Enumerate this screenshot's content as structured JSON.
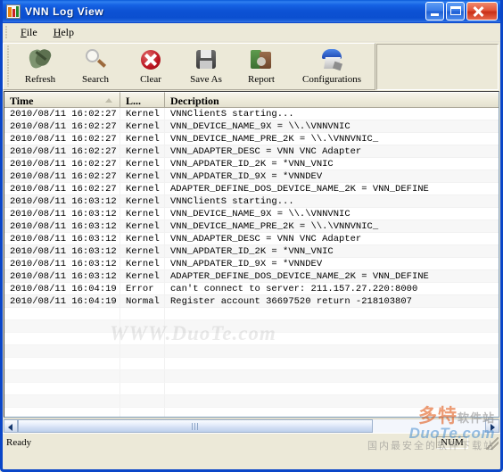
{
  "window": {
    "title": "VNN Log View",
    "icon": "app-icon",
    "controls": {
      "minimize": "Minimize",
      "maximize": "Maximize",
      "close": "Close"
    }
  },
  "menubar": {
    "items": [
      {
        "label": "File",
        "accel": "F"
      },
      {
        "label": "Help",
        "accel": "H"
      }
    ]
  },
  "toolbar": {
    "buttons": [
      {
        "label": "Refresh",
        "icon": "refresh-icon"
      },
      {
        "label": "Search",
        "icon": "search-icon"
      },
      {
        "label": "Clear",
        "icon": "clear-icon"
      },
      {
        "label": "Save As",
        "icon": "save-as-icon"
      },
      {
        "label": "Report",
        "icon": "report-icon"
      },
      {
        "label": "Configurations",
        "icon": "configurations-icon"
      }
    ]
  },
  "log": {
    "columns": [
      {
        "key": "time",
        "label": "Time",
        "sorted": "ascending"
      },
      {
        "key": "level",
        "label": "L..."
      },
      {
        "key": "desc",
        "label": "Decription"
      }
    ],
    "rows": [
      {
        "time": "2010/08/11 16:02:27",
        "level": "Kernel",
        "desc": "VNNClientS starting..."
      },
      {
        "time": "2010/08/11 16:02:27",
        "level": "Kernel",
        "desc": "VNN_DEVICE_NAME_9X = \\\\.\\VNNVNIC"
      },
      {
        "time": "2010/08/11 16:02:27",
        "level": "Kernel",
        "desc": "VNN_DEVICE_NAME_PRE_2K = \\\\.\\VNNVNIC_"
      },
      {
        "time": "2010/08/11 16:02:27",
        "level": "Kernel",
        "desc": "VNN_ADAPTER_DESC = VNN VNC Adapter"
      },
      {
        "time": "2010/08/11 16:02:27",
        "level": "Kernel",
        "desc": "VNN_APDATER_ID_2K = *VNN_VNIC"
      },
      {
        "time": "2010/08/11 16:02:27",
        "level": "Kernel",
        "desc": "VNN_APDATER_ID_9X = *VNNDEV"
      },
      {
        "time": "2010/08/11 16:02:27",
        "level": "Kernel",
        "desc": "ADAPTER_DEFINE_DOS_DEVICE_NAME_2K = VNN_DEFINE"
      },
      {
        "time": "2010/08/11 16:03:12",
        "level": "Kernel",
        "desc": "VNNClientS starting..."
      },
      {
        "time": "2010/08/11 16:03:12",
        "level": "Kernel",
        "desc": "VNN_DEVICE_NAME_9X = \\\\.\\VNNVNIC"
      },
      {
        "time": "2010/08/11 16:03:12",
        "level": "Kernel",
        "desc": "VNN_DEVICE_NAME_PRE_2K = \\\\.\\VNNVNIC_"
      },
      {
        "time": "2010/08/11 16:03:12",
        "level": "Kernel",
        "desc": "VNN_ADAPTER_DESC = VNN VNC Adapter"
      },
      {
        "time": "2010/08/11 16:03:12",
        "level": "Kernel",
        "desc": "VNN_APDATER_ID_2K = *VNN_VNIC"
      },
      {
        "time": "2010/08/11 16:03:12",
        "level": "Kernel",
        "desc": "VNN_APDATER_ID_9X = *VNNDEV"
      },
      {
        "time": "2010/08/11 16:03:12",
        "level": "Kernel",
        "desc": "ADAPTER_DEFINE_DOS_DEVICE_NAME_2K = VNN_DEFINE"
      },
      {
        "time": "2010/08/11 16:04:19",
        "level": "Error",
        "desc": "can't connect to server: 211.157.27.220:8000"
      },
      {
        "time": "2010/08/11 16:04:19",
        "level": "Normal",
        "desc": "Register account 36697520 return -218103807"
      }
    ],
    "empty_row_count": 9
  },
  "scrollbar": {
    "left_arrow": "scroll-left",
    "right_arrow": "scroll-right",
    "thumb": "horizontal-scroll-thumb"
  },
  "statusbar": {
    "message": "Ready",
    "num_indicator": "NUM"
  },
  "watermark": {
    "center": "WWW.DuoTe.com",
    "brand_cn": "多特",
    "brand_cn_suffix": "软件站",
    "brand_en": "DuoTe.com",
    "tagline": "国内最安全的软件下载站"
  }
}
